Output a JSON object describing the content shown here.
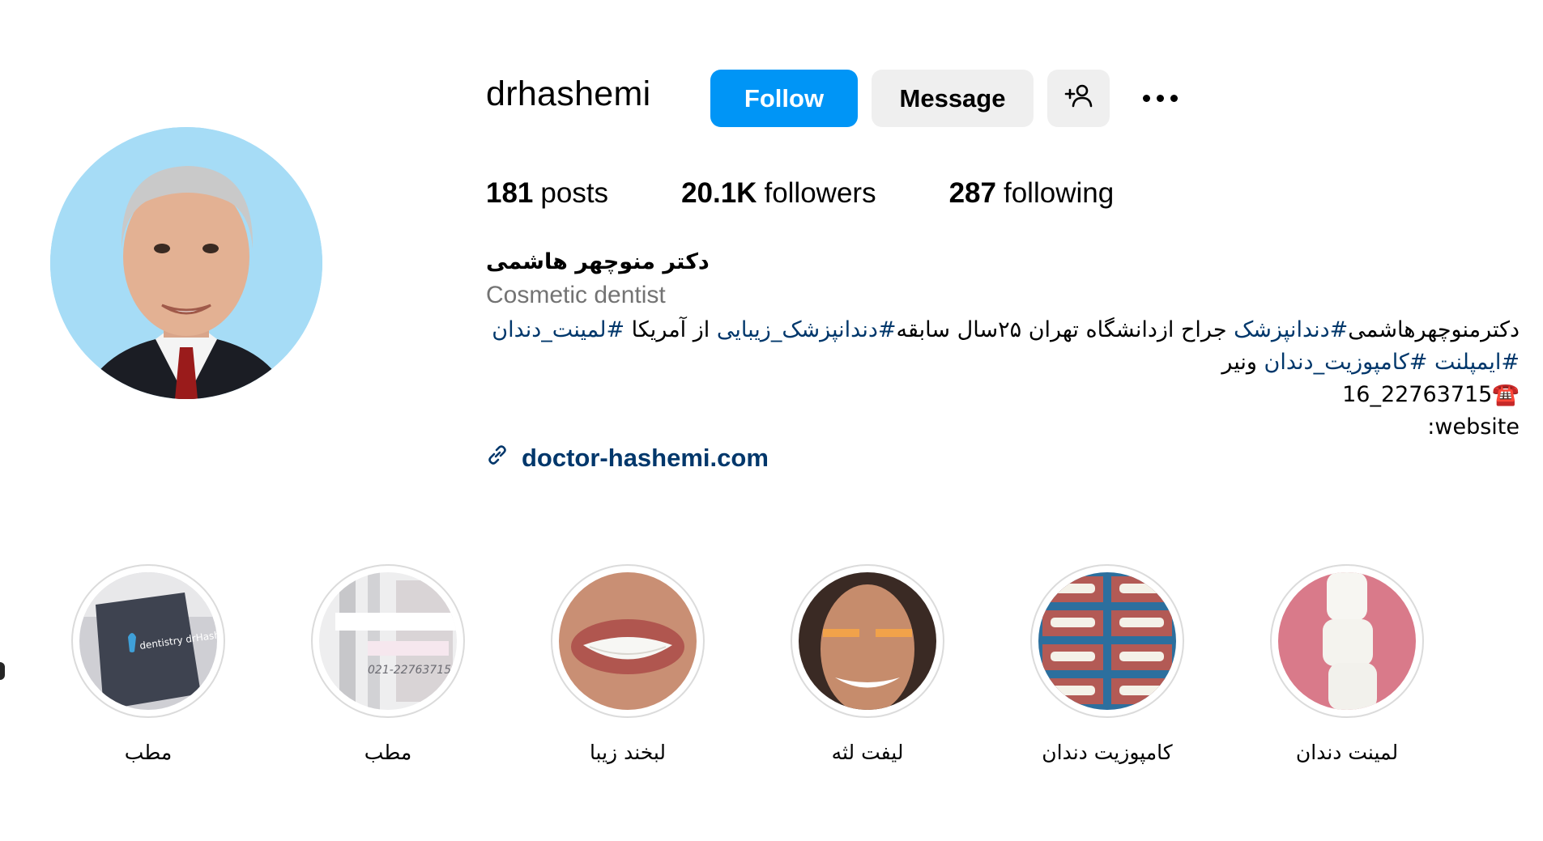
{
  "profile": {
    "username": "drhashemi",
    "full_name": "دکتر منوچهر هاشمی",
    "category": "Cosmetic dentist",
    "link": "doctor-hashemi.com"
  },
  "actions": {
    "follow_label": "Follow",
    "message_label": "Message",
    "add_user_icon": "person-plus-icon",
    "more_icon": "ellipsis-icon"
  },
  "stats": {
    "posts_count": "181",
    "posts_label": "posts",
    "followers_count": "20.1K",
    "followers_label": "followers",
    "following_count": "287",
    "following_label": "following"
  },
  "bio": {
    "line1_parts": [
      "دکترمنوچهرهاشمی",
      "#دندانپزشک",
      " جراح ازدانشگاه تهران ۲۵سال سابقه",
      "#دندانپزشک_زیبایی",
      " از آمریکا ",
      "#لمینت_دندان"
    ],
    "line2_parts": [
      "#ایمپلنت",
      " ",
      "#کامپوزیت_دندان",
      " ونیر"
    ],
    "phone_emoji": "☎️",
    "phone_text": "22763715_16",
    "website_label": "website:"
  },
  "highlights": [
    {
      "label": "مطب",
      "thumb_text": "dentistry drHashemi"
    },
    {
      "label": "مطب",
      "thumb_text": "021-22763715"
    },
    {
      "label": "لبخند زیبا"
    },
    {
      "label": "لیفت لثه"
    },
    {
      "label": "کامپوزیت دندان"
    },
    {
      "label": "لمینت دندان"
    }
  ],
  "colors": {
    "follow_button": "#0095f6",
    "secondary_button": "#efefef",
    "hashtag": "#00376b",
    "muted_text": "#737373"
  }
}
